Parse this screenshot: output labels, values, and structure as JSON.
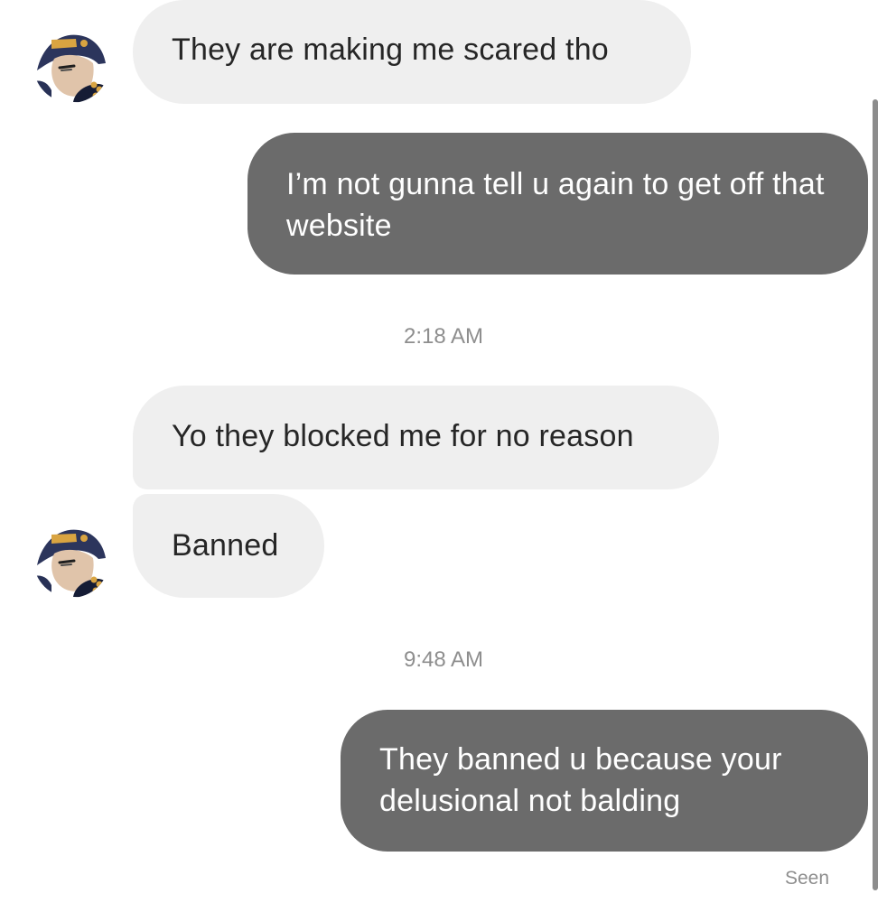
{
  "messages": {
    "m1": "They are making me scared tho",
    "m2": "I’m not gunna tell u again to get off that website",
    "m3": "Yo they blocked me for no reason",
    "m4": "Banned",
    "m5": "They banned u because your delusional not balding"
  },
  "timestamps": {
    "t1": "2:18 AM",
    "t2": "9:48 AM"
  },
  "status": {
    "seen": "Seen"
  },
  "icons": {
    "avatar": "avatar-icon"
  },
  "colors": {
    "incoming_bubble": "#efefef",
    "outgoing_bubble": "#6b6b6b",
    "muted_text": "#8e8e8e"
  }
}
